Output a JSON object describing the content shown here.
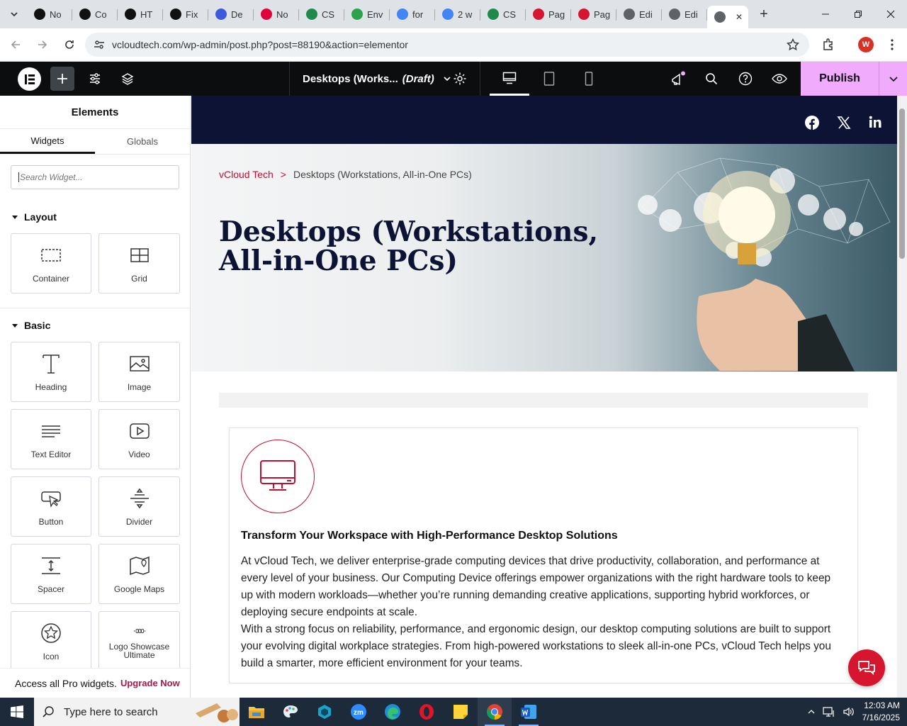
{
  "browser": {
    "tabs": [
      {
        "label": "No",
        "color": "#111111",
        "icon": "openai-icon"
      },
      {
        "label": "Co",
        "color": "#111111",
        "icon": "openai-icon"
      },
      {
        "label": "HT",
        "color": "#111111",
        "icon": "openai-icon"
      },
      {
        "label": "Fix",
        "color": "#111111",
        "icon": "openai-icon"
      },
      {
        "label": "De",
        "color": "#3b5bdb",
        "icon": "deepseek-icon"
      },
      {
        "label": "No",
        "color": "#e0003c",
        "icon": "youtube-icon"
      },
      {
        "label": "CS",
        "color": "#1f8a4c",
        "icon": "w-icon"
      },
      {
        "label": "Env",
        "color": "#2aa34a",
        "icon": "envato-icon"
      },
      {
        "label": "for",
        "color": "#4285f4",
        "icon": "google-icon"
      },
      {
        "label": "2 w",
        "color": "#4285f4",
        "icon": "google-icon"
      },
      {
        "label": "CS",
        "color": "#1f8a4c",
        "icon": "w-icon"
      },
      {
        "label": "Pag",
        "color": "#d6152f",
        "icon": "pagespeed-icon"
      },
      {
        "label": "Pag",
        "color": "#d6152f",
        "icon": "pagespeed-icon"
      },
      {
        "label": "Edi",
        "color": "#5f6368",
        "icon": "globe-icon"
      },
      {
        "label": "Edi",
        "color": "#5f6368",
        "icon": "globe-icon"
      }
    ],
    "url": "vcloudtech.com/wp-admin/post.php?post=88190&action=elementor",
    "profile_initial": "W"
  },
  "editor": {
    "doc_title": "Desktops (Works...",
    "doc_status": "(Draft)",
    "publish_label": "Publish"
  },
  "panel": {
    "title": "Elements",
    "tabs": [
      "Widgets",
      "Globals"
    ],
    "search_placeholder": "Search Widget...",
    "categories": [
      {
        "name": "Layout",
        "widgets": [
          "Container",
          "Grid"
        ]
      },
      {
        "name": "Basic",
        "widgets": [
          "Heading",
          "Image",
          "Text Editor",
          "Video",
          "Button",
          "Divider",
          "Spacer",
          "Google Maps",
          "Icon",
          "Logo Showcase Ultimate"
        ]
      }
    ],
    "pro_text": "Access all Pro widgets.",
    "pro_link": "Upgrade Now"
  },
  "page": {
    "breadcrumb_home": "vCloud Tech",
    "breadcrumb_sep": ">",
    "breadcrumb_current": "Desktops (Workstations, All-in-One PCs)",
    "hero_title": "Desktops (Workstations, All-in-One PCs)",
    "card_heading": "Transform Your Workspace with High-Performance Desktop Solutions",
    "card_p1": "At vCloud Tech, we deliver enterprise-grade computing devices that drive productivity, collaboration, and performance at every level of your business. Our Computing Device offerings empower organizations with the right hardware tools to keep up with modern workloads—whether you’re running demanding creative applications, supporting hybrid workforces, or deploying secure endpoints at scale.",
    "card_p2": "With a strong focus on reliability, performance, and ergonomic design, our desktop computing solutions are built to support your evolving digital workplace strategies. From high-powered workstations to sleek all-in-one PCs, vCloud Tech helps you build a smarter, more efficient environment for your teams.",
    "brand_color": "#c0102f",
    "navy": "#0c1334"
  },
  "taskbar": {
    "search_placeholder": "Type here to search",
    "time": "12:03 AM",
    "date": "7/16/2025"
  }
}
